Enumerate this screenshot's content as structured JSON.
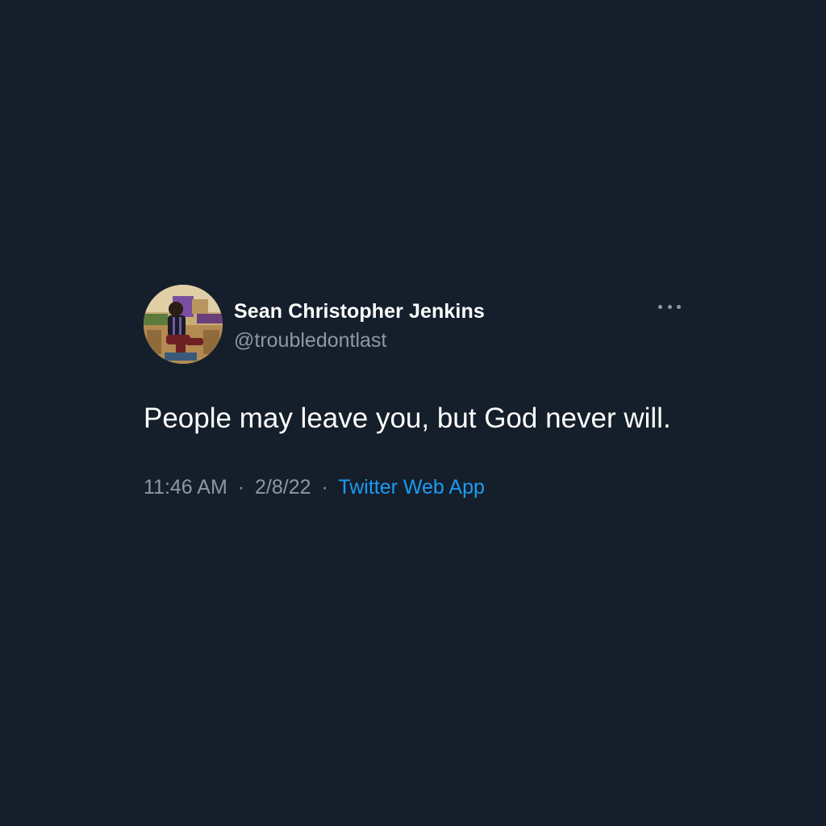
{
  "tweet": {
    "display_name": "Sean Christopher Jenkins",
    "handle": "@troubledontlast",
    "text": "People may leave you, but God never will.",
    "time": "11:46 AM",
    "separator": "·",
    "date": "2/8/22",
    "source": "Twitter Web App",
    "more_icon": "more-horizontal-icon"
  },
  "colors": {
    "background": "#151f2b",
    "primary_text": "#ffffff",
    "secondary_text": "#8b98a5",
    "link": "#1d9bf0"
  }
}
